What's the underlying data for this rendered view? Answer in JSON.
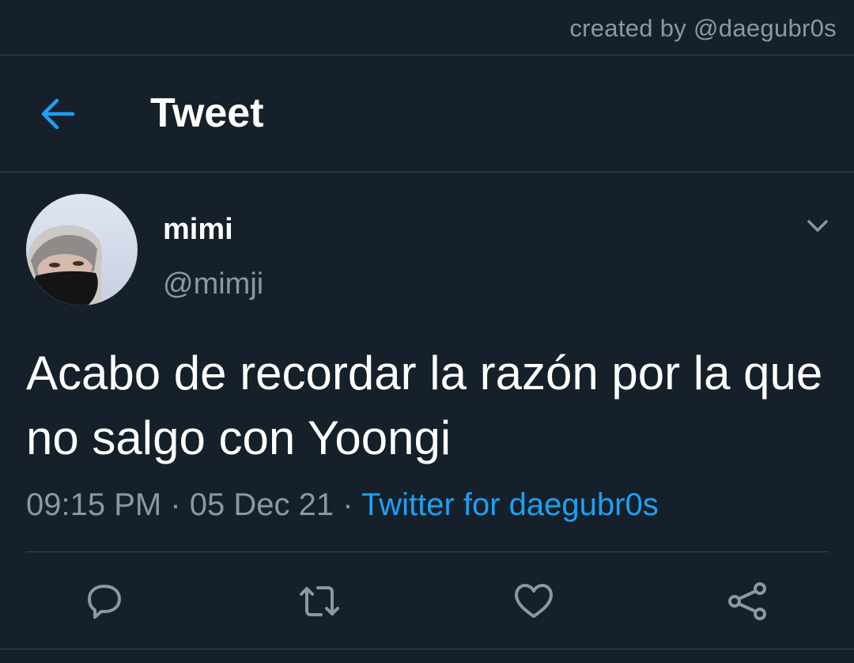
{
  "watermark": "created by @daegubr0s",
  "header": {
    "back_icon": "arrow-left-icon",
    "title": "Tweet"
  },
  "tweet": {
    "author": {
      "display_name": "mimi",
      "handle": "@mimji",
      "avatar": "profile-photo"
    },
    "menu_icon": "chevron-down-icon",
    "text": "Acabo de recordar la razón por la que no salgo con Yoongi",
    "time": "09:15 PM",
    "separator": "·",
    "date": "05 Dec 21",
    "source": "Twitter for daegubr0s"
  },
  "actions": [
    {
      "icon": "reply-icon"
    },
    {
      "icon": "retweet-icon"
    },
    {
      "icon": "like-icon"
    },
    {
      "icon": "share-icon"
    }
  ],
  "colors": {
    "background": "#15202b",
    "divider": "#38444d",
    "text_primary": "#ffffff",
    "text_secondary": "#8899a6",
    "accent": "#1da1f2"
  }
}
